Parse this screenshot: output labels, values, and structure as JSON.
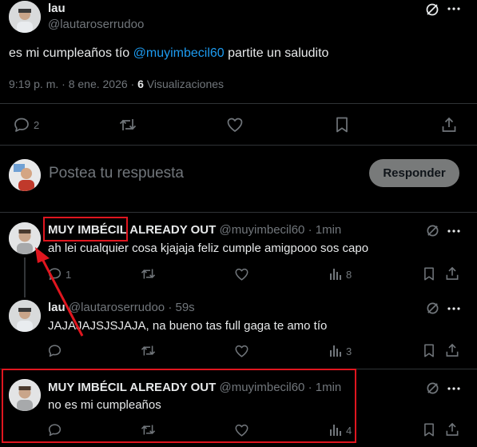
{
  "main_post": {
    "author_name": "lau",
    "author_handle": "@lautaroserrudoo",
    "text_before": "es mi cumpleaños tío ",
    "mention": "@muyimbecil60",
    "text_after": " partite un saludito",
    "meta_time": "9:19 p. m. · 8 ene. 2026 · ",
    "views_count": "6",
    "views_label": " Visualizaciones",
    "reply_count": "2"
  },
  "composer": {
    "placeholder": "Postea tu respuesta",
    "button_label": "Responder"
  },
  "replies": [
    {
      "author_name": "MUY IMBÉCIL ALREADY OUT",
      "author_handle": "@muyimbecil60",
      "time": "· 1min",
      "text": "ah lei cualquier cosa kjajaja feliz cumple amigpooo sos capo",
      "reply_count": "1",
      "views_count": "8"
    },
    {
      "author_name": "lau",
      "author_handle": "@lautaroserrudoo",
      "time": "· 59s",
      "text": "JAJAJAJSJSJAJA, na bueno tas full gaga te amo tío",
      "reply_count": "",
      "views_count": "3"
    },
    {
      "author_name": "MUY IMBÉCIL ALREADY OUT",
      "author_handle": "@muyimbecil60",
      "time": "· 1min",
      "text": "no es mi cumpleaños",
      "reply_count": "",
      "views_count": "4"
    }
  ],
  "colors": {
    "background": "#000000",
    "text": "#e7e9ea",
    "muted": "#71767b",
    "link": "#1d9bf0",
    "annotation_red": "#e0161f",
    "button": "#787a7a"
  }
}
